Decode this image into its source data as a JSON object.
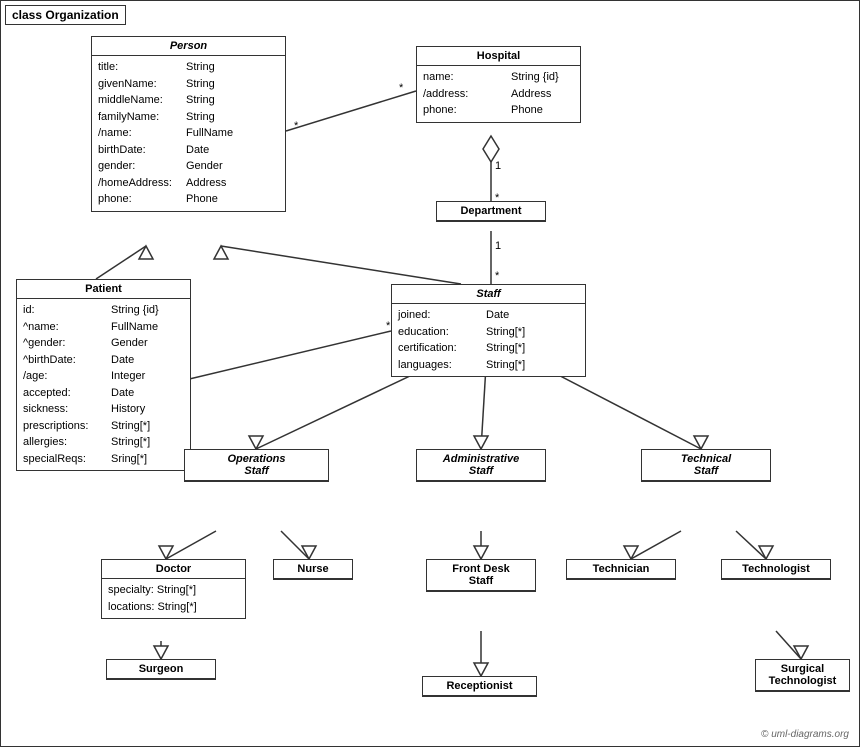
{
  "diagram": {
    "title": "class Organization",
    "copyright": "© uml-diagrams.org"
  },
  "classes": {
    "person": {
      "title": "Person",
      "italic": true,
      "attrs": [
        {
          "name": "title:",
          "type": "String"
        },
        {
          "name": "givenName:",
          "type": "String"
        },
        {
          "name": "middleName:",
          "type": "String"
        },
        {
          "name": "familyName:",
          "type": "String"
        },
        {
          "name": "/name:",
          "type": "FullName"
        },
        {
          "name": "birthDate:",
          "type": "Date"
        },
        {
          "name": "gender:",
          "type": "Gender"
        },
        {
          "name": "/homeAddress:",
          "type": "Address"
        },
        {
          "name": "phone:",
          "type": "Phone"
        }
      ]
    },
    "hospital": {
      "title": "Hospital",
      "italic": false,
      "attrs": [
        {
          "name": "name:",
          "type": "String {id}"
        },
        {
          "name": "/address:",
          "type": "Address"
        },
        {
          "name": "phone:",
          "type": "Phone"
        }
      ]
    },
    "patient": {
      "title": "Patient",
      "italic": false,
      "attrs": [
        {
          "name": "id:",
          "type": "String {id}"
        },
        {
          "name": "^name:",
          "type": "FullName"
        },
        {
          "name": "^gender:",
          "type": "Gender"
        },
        {
          "name": "^birthDate:",
          "type": "Date"
        },
        {
          "name": "/age:",
          "type": "Integer"
        },
        {
          "name": "accepted:",
          "type": "Date"
        },
        {
          "name": "sickness:",
          "type": "History"
        },
        {
          "name": "prescriptions:",
          "type": "String[*]"
        },
        {
          "name": "allergies:",
          "type": "String[*]"
        },
        {
          "name": "specialReqs:",
          "type": "Sring[*]"
        }
      ]
    },
    "department": {
      "title": "Department",
      "italic": false,
      "attrs": []
    },
    "staff": {
      "title": "Staff",
      "italic": true,
      "attrs": [
        {
          "name": "joined:",
          "type": "Date"
        },
        {
          "name": "education:",
          "type": "String[*]"
        },
        {
          "name": "certification:",
          "type": "String[*]"
        },
        {
          "name": "languages:",
          "type": "String[*]"
        }
      ]
    },
    "operations_staff": {
      "title": "Operations Staff",
      "italic": true,
      "attrs": []
    },
    "administrative_staff": {
      "title": "Administrative Staff",
      "italic": true,
      "attrs": []
    },
    "technical_staff": {
      "title": "Technical Staff",
      "italic": true,
      "attrs": []
    },
    "doctor": {
      "title": "Doctor",
      "italic": false,
      "attrs": [
        {
          "name": "specialty:",
          "type": "String[*]"
        },
        {
          "name": "locations:",
          "type": "String[*]"
        }
      ]
    },
    "nurse": {
      "title": "Nurse",
      "italic": false,
      "attrs": []
    },
    "front_desk_staff": {
      "title": "Front Desk Staff",
      "italic": false,
      "attrs": []
    },
    "technician": {
      "title": "Technician",
      "italic": false,
      "attrs": []
    },
    "technologist": {
      "title": "Technologist",
      "italic": false,
      "attrs": []
    },
    "surgeon": {
      "title": "Surgeon",
      "italic": false,
      "attrs": []
    },
    "receptionist": {
      "title": "Receptionist",
      "italic": false,
      "attrs": []
    },
    "surgical_technologist": {
      "title": "Surgical Technologist",
      "italic": false,
      "attrs": []
    }
  }
}
